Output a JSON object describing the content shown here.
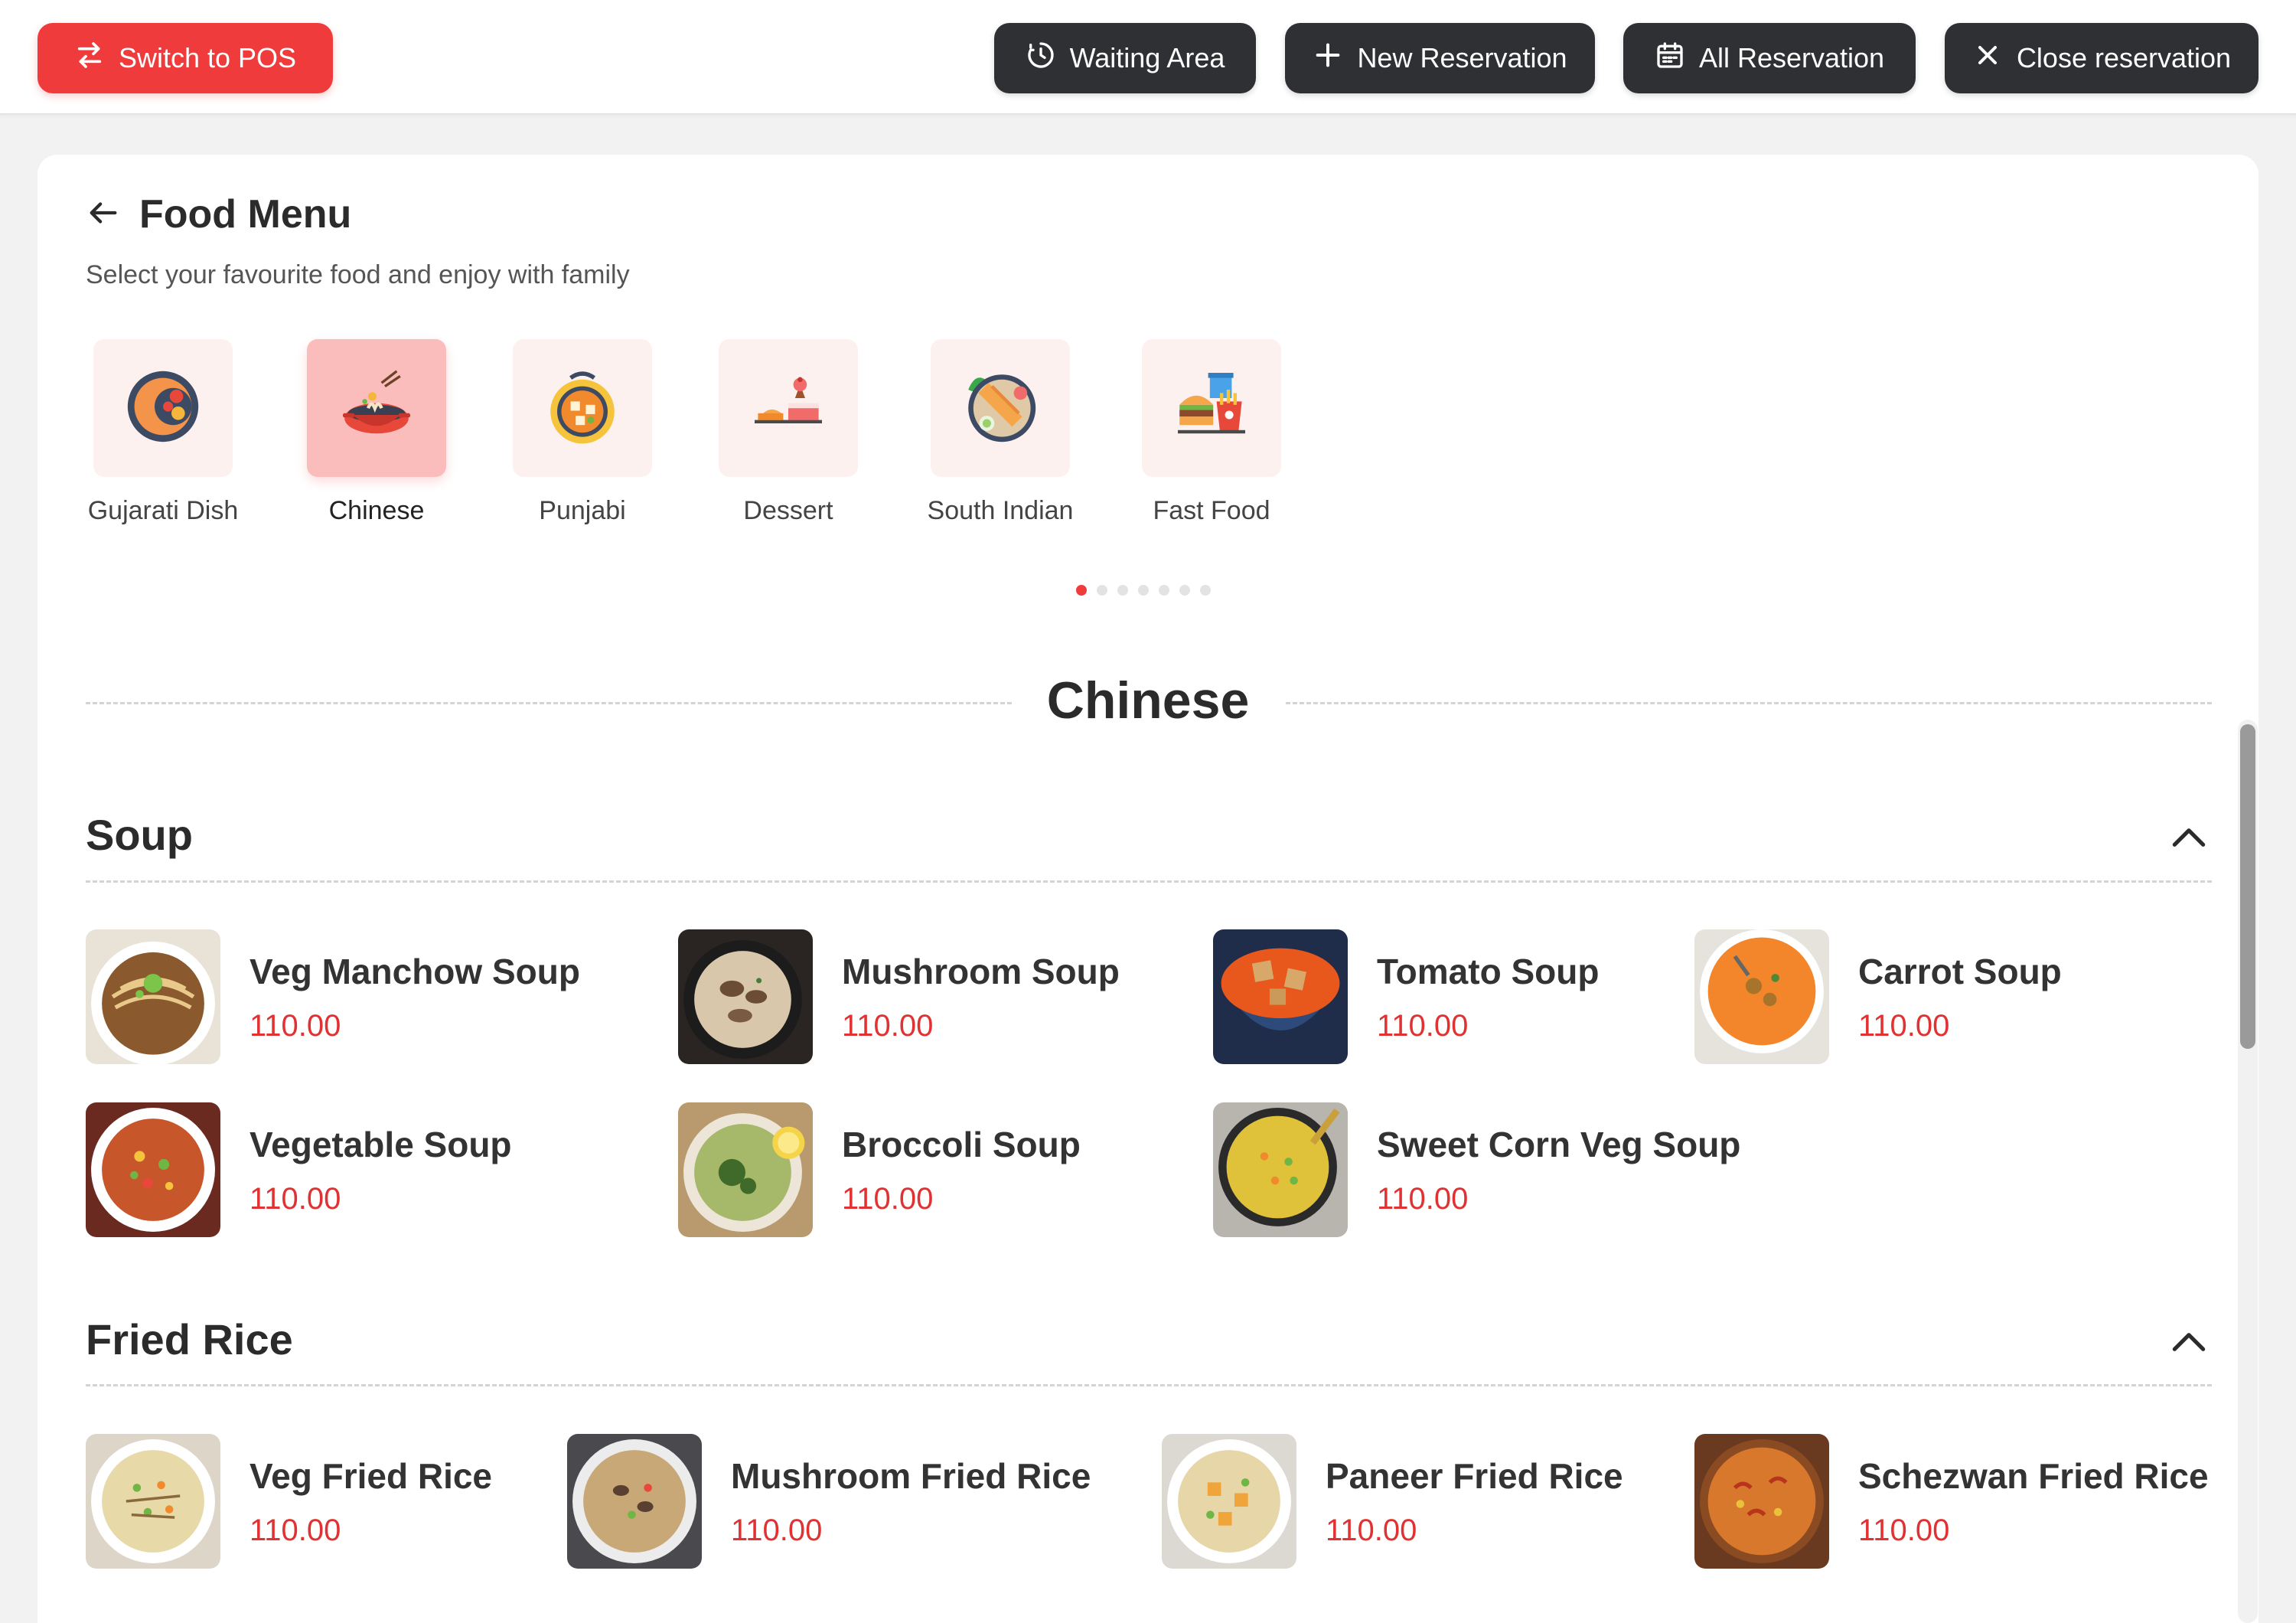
{
  "topbar": {
    "switch_pos": "Switch to POS",
    "waiting_area": "Waiting Area",
    "new_reservation": "New Reservation",
    "all_reservation": "All Reservation",
    "close_reservation": "Close reservation"
  },
  "menu": {
    "title": "Food Menu",
    "subtitle": "Select your favourite food and enjoy with family",
    "categories": [
      {
        "label": "Gujarati Dish",
        "icon": "gujarati-dish-icon",
        "active": false
      },
      {
        "label": "Chinese",
        "icon": "chinese-icon",
        "active": true
      },
      {
        "label": "Punjabi",
        "icon": "punjabi-icon",
        "active": false
      },
      {
        "label": "Dessert",
        "icon": "dessert-icon",
        "active": false
      },
      {
        "label": "South Indian",
        "icon": "south-indian-icon",
        "active": false
      },
      {
        "label": "Fast Food",
        "icon": "fast-food-icon",
        "active": false
      }
    ],
    "carousel_pages": 7,
    "carousel_active": 1
  },
  "section": {
    "title": "Chinese",
    "groups": [
      {
        "title": "Soup",
        "items": [
          {
            "name": "Veg Manchow Soup",
            "price": "110.00"
          },
          {
            "name": "Mushroom Soup",
            "price": "110.00"
          },
          {
            "name": "Tomato Soup",
            "price": "110.00"
          },
          {
            "name": "Carrot Soup",
            "price": "110.00"
          },
          {
            "name": "Vegetable Soup",
            "price": "110.00"
          },
          {
            "name": "Broccoli Soup",
            "price": "110.00"
          },
          {
            "name": "Sweet Corn Veg Soup",
            "price": "110.00"
          }
        ]
      },
      {
        "title": "Fried Rice",
        "items": [
          {
            "name": "Veg Fried Rice",
            "price": "110.00"
          },
          {
            "name": "Mushroom Fried Rice",
            "price": "110.00"
          },
          {
            "name": "Paneer Fried Rice",
            "price": "110.00"
          },
          {
            "name": "Schezwan Fried Rice",
            "price": "110.00"
          }
        ]
      }
    ]
  },
  "colors": {
    "accent": "#ef3b3b",
    "price": "#e03232",
    "dark_button": "#2f3033",
    "active_category_bg": "#fbbcbc",
    "category_bg": "#fdf1f0"
  }
}
